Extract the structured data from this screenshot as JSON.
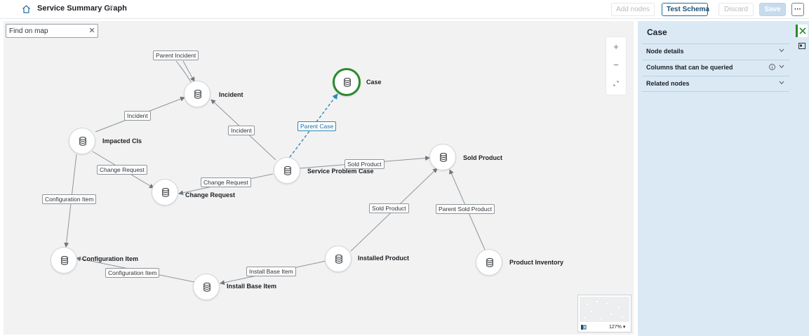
{
  "header": {
    "title": "Service Summary Graph",
    "buttons": {
      "add_nodes": "Add nodes",
      "test_schema": "Test Schema",
      "discard": "Discard",
      "save": "Save",
      "more": "···"
    }
  },
  "canvas": {
    "search": {
      "placeholder": "Find on map",
      "value": ""
    },
    "zoom_controls": {
      "zoom_in": "+",
      "zoom_out": "−"
    },
    "nodes": [
      {
        "id": "incident",
        "label": "Incident"
      },
      {
        "id": "case",
        "label": "Case",
        "selected": true
      },
      {
        "id": "impacted-cis",
        "label": "Impacted CIs"
      },
      {
        "id": "service-problem-case",
        "label": "Service Problem Case"
      },
      {
        "id": "sold-product",
        "label": "Sold Product"
      },
      {
        "id": "change-request",
        "label": "Change Request"
      },
      {
        "id": "configuration-item",
        "label": "Configuration Item"
      },
      {
        "id": "installed-product",
        "label": "Installed Product"
      },
      {
        "id": "product-inventory",
        "label": "Product Inventory"
      },
      {
        "id": "install-base-item",
        "label": "Install Base Item"
      }
    ],
    "edge_labels": [
      {
        "id": "parent-incident",
        "text": "Parent Incident"
      },
      {
        "id": "incident-from-impacted",
        "text": "Incident"
      },
      {
        "id": "incident-from-spc",
        "text": "Incident"
      },
      {
        "id": "parent-case",
        "text": "Parent Case",
        "selected": true
      },
      {
        "id": "sold-product-from-spc",
        "text": "Sold Product"
      },
      {
        "id": "change-request-from-impacted",
        "text": "Change Request"
      },
      {
        "id": "change-request-from-spc",
        "text": "Change Request"
      },
      {
        "id": "configuration-item-from-impacted",
        "text": "Configuration Item"
      },
      {
        "id": "sold-product-from-installed",
        "text": "Sold Product"
      },
      {
        "id": "parent-sold-product",
        "text": "Parent Sold Product"
      },
      {
        "id": "configuration-item-from-ibi",
        "text": "Configuration Item"
      },
      {
        "id": "install-base-item-from-installed",
        "text": "Install Base Item"
      }
    ],
    "minimap": {
      "zoom": "127% ▾"
    }
  },
  "panel": {
    "title": "Case",
    "sections": [
      {
        "label": "Node details"
      },
      {
        "label": "Columns that can be queried",
        "info": true
      },
      {
        "label": "Related nodes"
      }
    ]
  },
  "colors": {
    "selected_node_ring": "#2a8a2e",
    "selected_edge": "#2c88b9",
    "panel_bg": "#dbe9f5",
    "canvas_bg": "#f2f2f2"
  }
}
